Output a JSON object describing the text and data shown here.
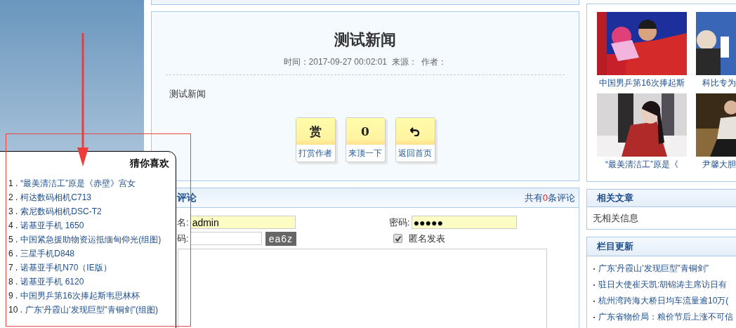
{
  "article": {
    "title": "测试新闻",
    "meta": "时间：2017-09-27 00:02:01  来源：  作者：",
    "body": "测试新闻",
    "actions": [
      {
        "kind": "text",
        "symbol": "赏",
        "label": "打赏作者"
      },
      {
        "kind": "text",
        "symbol": "0",
        "label": "来顶一下"
      },
      {
        "kind": "return",
        "label": "返回首页"
      }
    ]
  },
  "comments": {
    "title": "评论",
    "count_before": "共有",
    "count": "0",
    "count_after": "条评论",
    "name_label": "名:",
    "name_value": "admin",
    "password_label": "密码:",
    "password_value": "●●●●●",
    "captcha_label": "码:",
    "captcha_code": "ea6z",
    "anonymous": {
      "label": "匿名发表",
      "checked": true
    }
  },
  "gallery": [
    {
      "caption": "中国男乒第16次捧起斯"
    },
    {
      "caption": "科比专为"
    },
    {
      "caption": "“最美清洁工”原是《"
    },
    {
      "caption": "尹馨大胆"
    }
  ],
  "related": {
    "title": "相关文章",
    "text": "无相关信息"
  },
  "updates": {
    "title": "栏目更新",
    "items": [
      "广东'丹霞山'发现巨型\"青铜剑\"",
      "驻日大使崔天凯:胡锦涛主席访日有",
      "杭州湾跨海大桥日均车流量逾10万(",
      "广东省物价局：粮价节后上涨不可信"
    ]
  },
  "popup": {
    "title": "猜你喜欢",
    "items": [
      {
        "number": "1 .",
        "text": " “最美清洁工”原是《赤壁》宫女"
      },
      {
        "number": "2 .",
        "text": "柯达数码相机C713"
      },
      {
        "number": "3 .",
        "text": "索尼数码相机DSC-T2"
      },
      {
        "number": "4 .",
        "text": "诺基亚手机 1650"
      },
      {
        "number": "5 .",
        "text": "中国紧急援助物资运抵缅甸仰光(组图)"
      },
      {
        "number": "6 .",
        "text": "三星手机D848"
      },
      {
        "number": "7 .",
        "text": "诺基亚手机N70（IE版）"
      },
      {
        "number": "8 .",
        "text": "诺基亚手机 6120"
      },
      {
        "number": "9 .",
        "text": "中国男乒第16次捧起斯韦思林杯"
      },
      {
        "number": "10 .",
        "text": "广东'丹霞山'发现巨型\"青铜剑\"(组图)"
      }
    ]
  }
}
